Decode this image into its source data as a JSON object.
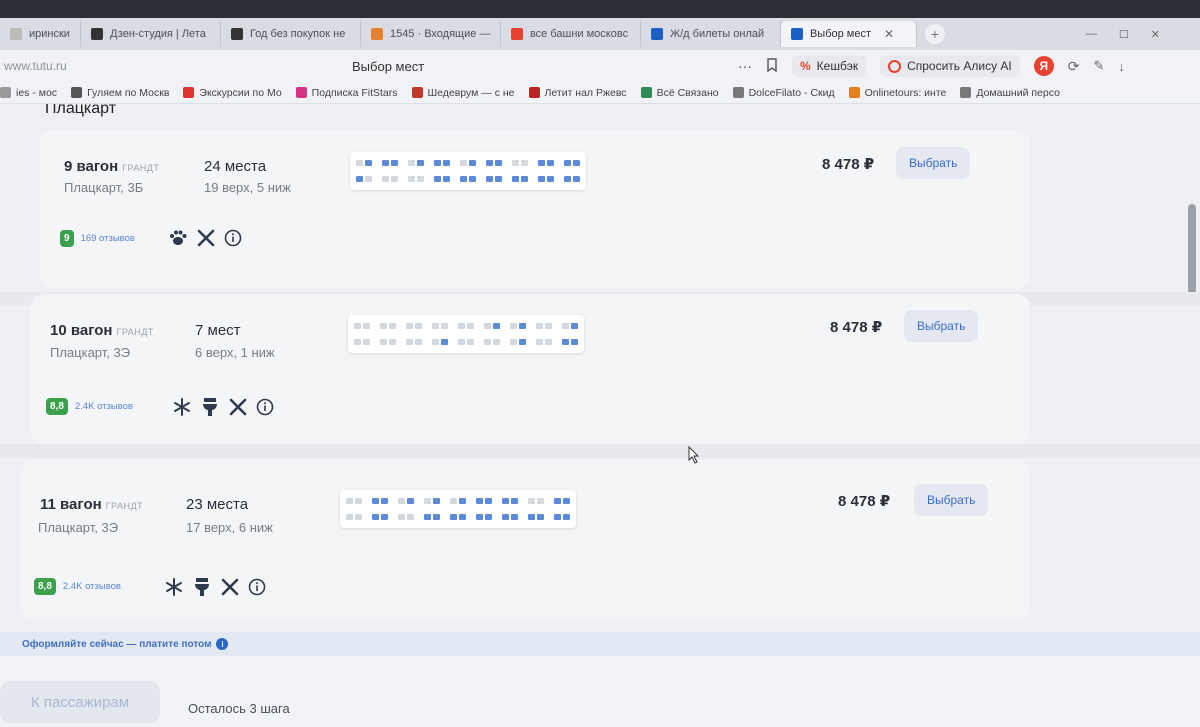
{
  "browser": {
    "tabs": [
      {
        "label": "ирински",
        "fav": "#bbb"
      },
      {
        "label": "Дзен-студия | Лета",
        "fav": "#333"
      },
      {
        "label": "Год без покупок не",
        "fav": "#333"
      },
      {
        "label": "1545 · Входящие —",
        "fav": "#e8812f"
      },
      {
        "label": "все башни московс",
        "fav": "#e8412f"
      },
      {
        "label": "Ж/д билеты онлай",
        "fav": "#1c5fc4"
      },
      {
        "label": "Выбор мест",
        "fav": "#1c5fc4",
        "active": true
      }
    ],
    "url": "www.tutu.ru",
    "page_title": "Выбор мест",
    "cashback": "Кешбэк",
    "alice": "Спросить Алису AI",
    "yandex_letter": "Я",
    "bookmarks": [
      {
        "label": "ies - мос",
        "color": "#999"
      },
      {
        "label": "Гуляем по Москв",
        "color": "#555"
      },
      {
        "label": "Экскурсии по Мо",
        "color": "#d33"
      },
      {
        "label": "Подписка FitStars",
        "color": "#d63384"
      },
      {
        "label": "Шедеврум — с не",
        "color": "#c0392b"
      },
      {
        "label": "Летит нал Ржевс",
        "color": "#b22"
      },
      {
        "label": "Всё Связано",
        "color": "#2e8b57"
      },
      {
        "label": "DolceFilato - Скид",
        "color": "#777"
      },
      {
        "label": "Onlinetours: инте",
        "color": "#e67e22"
      },
      {
        "label": "Домашний персо",
        "color": "#777"
      }
    ]
  },
  "section_title": "Плацкарт",
  "wagons": [
    {
      "name": "9 вагон",
      "cls": "ГРАНДТ",
      "type": "Плацкарт, 3Б",
      "seats": "24 места",
      "split": "19 верх, 5 ниж",
      "price": "8 478 ₽",
      "button": "Выбрать",
      "rating": "9",
      "reviews": "169 отзывов",
      "amenities": [
        "paw-icon",
        "cutlery-icon",
        "info-icon"
      ],
      "top_row": [
        0,
        1,
        1,
        1,
        0,
        1,
        1,
        1,
        0,
        1,
        1,
        1,
        0,
        0,
        1,
        1,
        1,
        1
      ],
      "bottom_row": [
        1,
        0,
        0,
        0,
        0,
        0,
        1,
        1,
        1,
        1,
        1,
        1,
        1,
        1,
        1,
        1,
        1,
        1
      ]
    },
    {
      "name": "10 вагон",
      "cls": "ГРАНДТ",
      "type": "Плацкарт, 3Э",
      "seats": "7 мест",
      "split": "6 верх, 1 ниж",
      "price": "8 478 ₽",
      "button": "Выбрать",
      "rating": "8,8",
      "reviews": "2.4K отзывов",
      "amenities": [
        "snowflake-icon",
        "toilet-icon",
        "cutlery-icon",
        "info-icon"
      ],
      "top_row": [
        0,
        0,
        0,
        0,
        0,
        0,
        0,
        0,
        0,
        0,
        0,
        1,
        0,
        1,
        0,
        0,
        0,
        1
      ],
      "bottom_row": [
        0,
        0,
        0,
        0,
        0,
        0,
        0,
        1,
        0,
        0,
        0,
        0,
        0,
        1,
        0,
        0,
        1,
        1
      ]
    },
    {
      "name": "11 вагон",
      "cls": "ГРАНДТ",
      "type": "Плацкарт, 3Э",
      "seats": "23 места",
      "split": "17 верх, 6 ниж",
      "price": "8 478 ₽",
      "button": "Выбрать",
      "rating": "8,8",
      "reviews": "2.4K отзывов",
      "amenities": [
        "snowflake-icon",
        "toilet-icon",
        "cutlery-icon",
        "info-icon"
      ],
      "top_row": [
        0,
        0,
        1,
        1,
        0,
        1,
        0,
        1,
        0,
        1,
        1,
        1,
        1,
        1,
        0,
        0,
        1,
        1
      ],
      "bottom_row": [
        0,
        0,
        1,
        1,
        0,
        0,
        1,
        1,
        1,
        1,
        1,
        1,
        1,
        1,
        1,
        1,
        1,
        1
      ]
    }
  ],
  "promo": "Оформляйте сейчас — платите потом",
  "footer": {
    "next_button": "К пассажирам",
    "steps_left": "Осталось 3 шага"
  },
  "colors": {
    "seat_free": "#5b8bd9",
    "seat_taken": "#d3d7de",
    "rating": "#3aa14a",
    "accent": "#3b6cc4"
  }
}
